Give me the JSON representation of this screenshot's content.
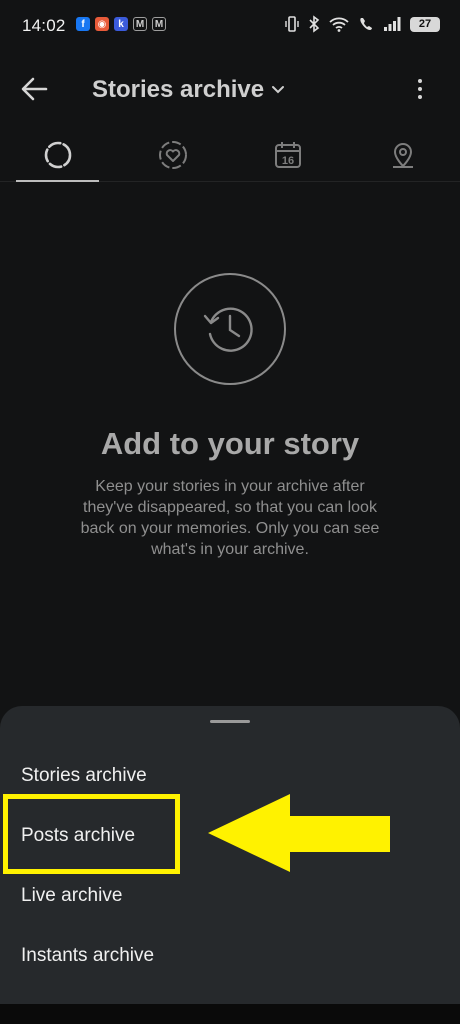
{
  "status_bar": {
    "time": "14:02",
    "battery": "27",
    "notification_icons": [
      {
        "name": "facebook-icon",
        "glyph": "f",
        "color": "#1877f2"
      },
      {
        "name": "camera-app-icon",
        "glyph": "◉",
        "color": "#e85b3a"
      },
      {
        "name": "k-app-icon",
        "glyph": "k",
        "color": "#3b5bdb"
      },
      {
        "name": "gmail-icon",
        "glyph": "M",
        "color": "#9e9e9e"
      },
      {
        "name": "gmail-icon",
        "glyph": "M",
        "color": "#9e9e9e"
      }
    ]
  },
  "header": {
    "title": "Stories archive"
  },
  "tabs": [
    {
      "name": "tab-stories",
      "icon": "dashed-circle-icon",
      "active": true
    },
    {
      "name": "tab-memories",
      "icon": "heart-circle-icon",
      "active": false
    },
    {
      "name": "tab-calendar",
      "icon": "calendar-icon",
      "calendar_day": "16",
      "active": false
    },
    {
      "name": "tab-map",
      "icon": "location-pin-icon",
      "active": false
    }
  ],
  "empty_state": {
    "title": "Add to your story",
    "description": "Keep your stories in your archive after they've disappeared, so that you can look back on your memories. Only you can see what's in your archive."
  },
  "sheet": {
    "items": [
      {
        "label": "Stories archive"
      },
      {
        "label": "Posts archive"
      },
      {
        "label": "Live archive"
      },
      {
        "label": "Instants archive"
      }
    ]
  },
  "annotation": {
    "highlight_color": "#fff200"
  }
}
